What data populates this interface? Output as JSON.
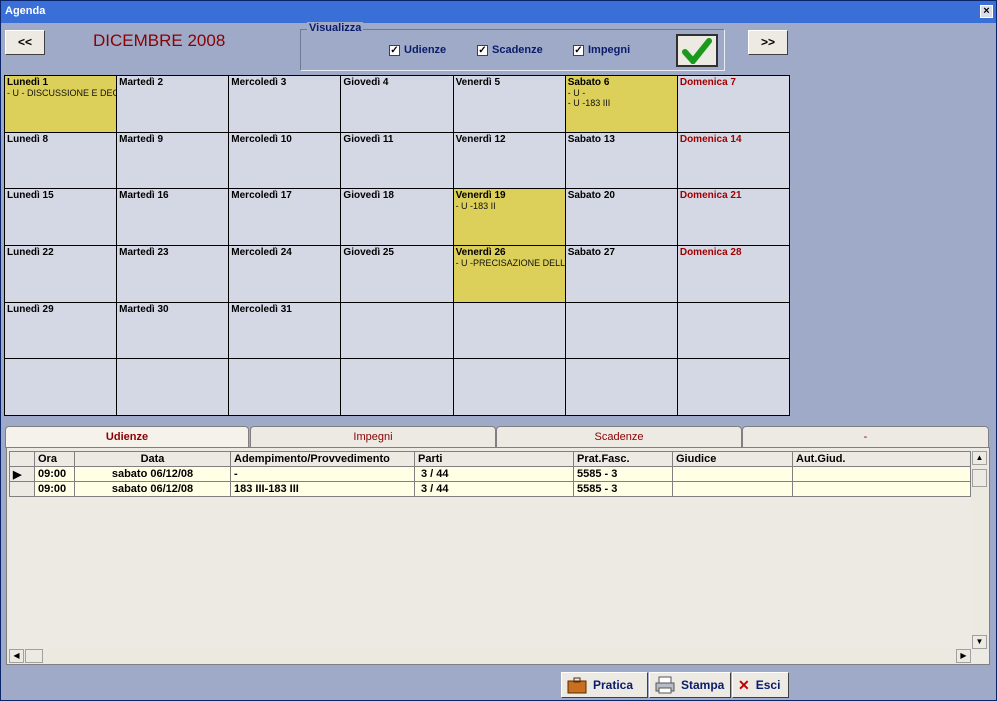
{
  "window": {
    "title": "Agenda",
    "close": "×"
  },
  "nav": {
    "prev": "<<",
    "next": ">>"
  },
  "month": "DICEMBRE 2008",
  "visualizza": {
    "legend": "Visualizza",
    "options": [
      {
        "label": "Udienze",
        "checked": true
      },
      {
        "label": "Scadenze",
        "checked": true
      },
      {
        "label": "Impegni",
        "checked": true
      }
    ]
  },
  "calendar": [
    {
      "day": "Lunedì 1",
      "sun": false,
      "hl": true,
      "events": [
        "- U - DISCUSSIONE E DECI"
      ]
    },
    {
      "day": "Martedì 2",
      "sun": false,
      "hl": false,
      "events": []
    },
    {
      "day": "Mercoledì 3",
      "sun": false,
      "hl": false,
      "events": []
    },
    {
      "day": "Giovedì 4",
      "sun": false,
      "hl": false,
      "events": []
    },
    {
      "day": "Venerdì 5",
      "sun": false,
      "hl": false,
      "events": []
    },
    {
      "day": "Sabato 6",
      "sun": false,
      "hl": true,
      "events": [
        "- U -",
        "- U -183 III"
      ]
    },
    {
      "day": "Domenica 7",
      "sun": true,
      "hl": false,
      "events": []
    },
    {
      "day": "Lunedì 8",
      "sun": false,
      "hl": false,
      "events": []
    },
    {
      "day": "Martedì 9",
      "sun": false,
      "hl": false,
      "events": []
    },
    {
      "day": "Mercoledì 10",
      "sun": false,
      "hl": false,
      "events": []
    },
    {
      "day": "Giovedì 11",
      "sun": false,
      "hl": false,
      "events": []
    },
    {
      "day": "Venerdì 12",
      "sun": false,
      "hl": false,
      "events": []
    },
    {
      "day": "Sabato 13",
      "sun": false,
      "hl": false,
      "events": []
    },
    {
      "day": "Domenica 14",
      "sun": true,
      "hl": false,
      "events": []
    },
    {
      "day": "Lunedì 15",
      "sun": false,
      "hl": false,
      "events": []
    },
    {
      "day": "Martedì 16",
      "sun": false,
      "hl": false,
      "events": []
    },
    {
      "day": "Mercoledì 17",
      "sun": false,
      "hl": false,
      "events": []
    },
    {
      "day": "Giovedì 18",
      "sun": false,
      "hl": false,
      "events": []
    },
    {
      "day": "Venerdì 19",
      "sun": false,
      "hl": true,
      "events": [
        "- U -183 II"
      ]
    },
    {
      "day": "Sabato 20",
      "sun": false,
      "hl": false,
      "events": []
    },
    {
      "day": "Domenica 21",
      "sun": true,
      "hl": false,
      "events": []
    },
    {
      "day": "Lunedì 22",
      "sun": false,
      "hl": false,
      "events": []
    },
    {
      "day": "Martedì 23",
      "sun": false,
      "hl": false,
      "events": []
    },
    {
      "day": "Mercoledì 24",
      "sun": false,
      "hl": false,
      "events": []
    },
    {
      "day": "Giovedì 25",
      "sun": false,
      "hl": false,
      "events": []
    },
    {
      "day": "Venerdì 26",
      "sun": false,
      "hl": true,
      "events": [
        "- U -PRECISAZIONE DELLE"
      ]
    },
    {
      "day": "Sabato 27",
      "sun": false,
      "hl": false,
      "events": []
    },
    {
      "day": "Domenica 28",
      "sun": true,
      "hl": false,
      "events": []
    },
    {
      "day": "Lunedì 29",
      "sun": false,
      "hl": false,
      "events": []
    },
    {
      "day": "Martedì 30",
      "sun": false,
      "hl": false,
      "events": []
    },
    {
      "day": "Mercoledì 31",
      "sun": false,
      "hl": false,
      "events": []
    },
    {
      "day": "",
      "sun": false,
      "hl": false,
      "events": []
    },
    {
      "day": "",
      "sun": false,
      "hl": false,
      "events": []
    },
    {
      "day": "",
      "sun": false,
      "hl": false,
      "events": []
    },
    {
      "day": "",
      "sun": false,
      "hl": false,
      "events": []
    },
    {
      "day": "",
      "sun": false,
      "hl": false,
      "events": []
    },
    {
      "day": "",
      "sun": false,
      "hl": false,
      "events": []
    },
    {
      "day": "",
      "sun": false,
      "hl": false,
      "events": []
    },
    {
      "day": "",
      "sun": false,
      "hl": false,
      "events": []
    },
    {
      "day": "",
      "sun": false,
      "hl": false,
      "events": []
    },
    {
      "day": "",
      "sun": false,
      "hl": false,
      "events": []
    },
    {
      "day": "",
      "sun": false,
      "hl": false,
      "events": []
    }
  ],
  "tabs": [
    {
      "label": "Udienze",
      "active": true
    },
    {
      "label": "Impegni",
      "active": false
    },
    {
      "label": "Scadenze",
      "active": false
    },
    {
      "label": "-",
      "active": false
    }
  ],
  "table": {
    "columns": [
      "",
      "Ora",
      "Data",
      "Adempimento/Provvedimento",
      "Parti",
      "Prat.Fasc.",
      "Giudice",
      "Aut.Giud."
    ],
    "rows": [
      [
        "▶",
        "09:00",
        "sabato 06/12/08",
        "-",
        "3 / 44",
        "5585 - 3",
        "",
        ""
      ],
      [
        "",
        "09:00",
        "sabato 06/12/08",
        "183 III-183 III",
        "3 / 44",
        "5585 - 3",
        "",
        ""
      ]
    ]
  },
  "buttons": {
    "pratica": "Pratica",
    "stampa": "Stampa",
    "esci": "Esci"
  },
  "colors": {
    "highlight": "#ddd05a",
    "sunday": "#a00000",
    "month": "#8b0000"
  }
}
